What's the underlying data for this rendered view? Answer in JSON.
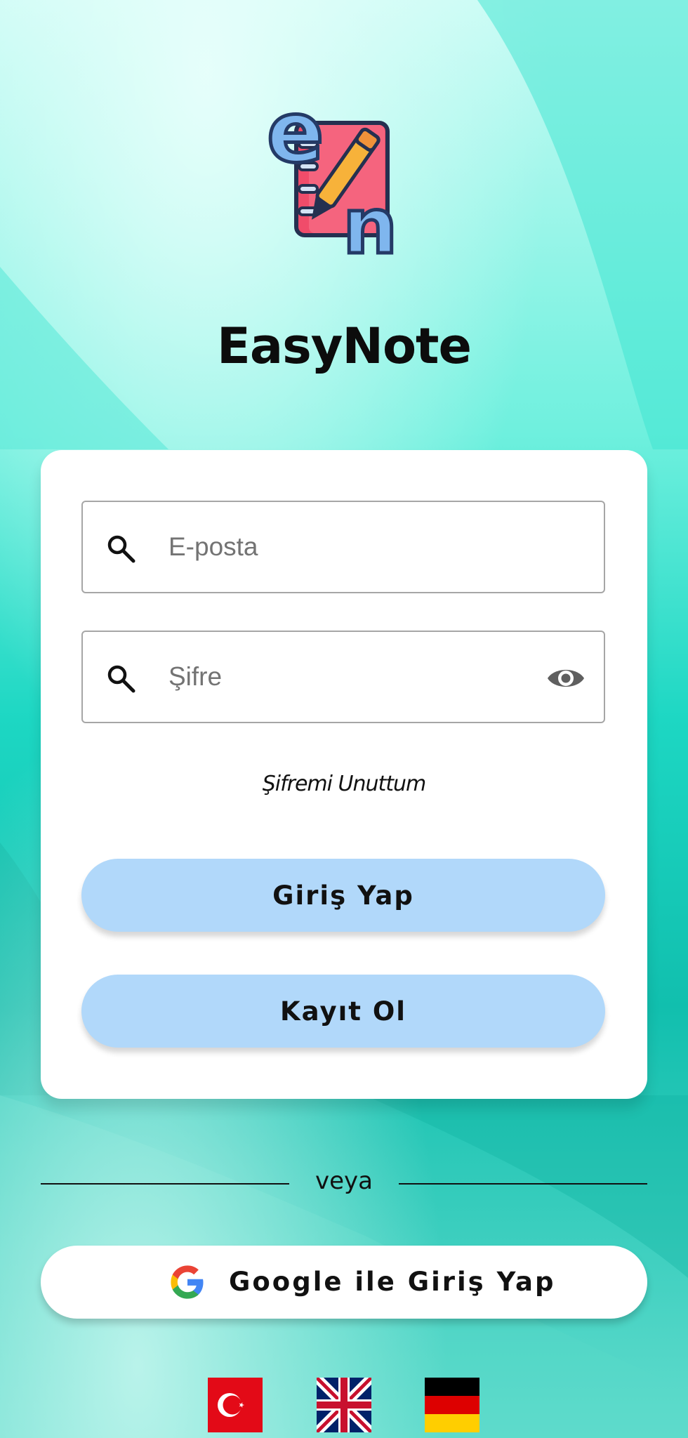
{
  "app": {
    "title": "EasyNote",
    "logo_text": "en"
  },
  "login_form": {
    "email_placeholder": "E-posta",
    "password_placeholder": "Şifre",
    "forgot_password_label": "Şifremi Unuttum",
    "login_label": "Giriş Yap",
    "register_label": "Kayıt Ol"
  },
  "divider": {
    "text": "veya"
  },
  "google": {
    "label": "Google ile Giriş Yap"
  },
  "languages": [
    {
      "name": "turkish-flag-icon"
    },
    {
      "name": "uk-flag-icon"
    },
    {
      "name": "german-flag-icon"
    }
  ],
  "colors": {
    "button_bg": "#b1d8fa",
    "background_teal": "#2ad8c4",
    "card_bg": "#ffffff"
  }
}
